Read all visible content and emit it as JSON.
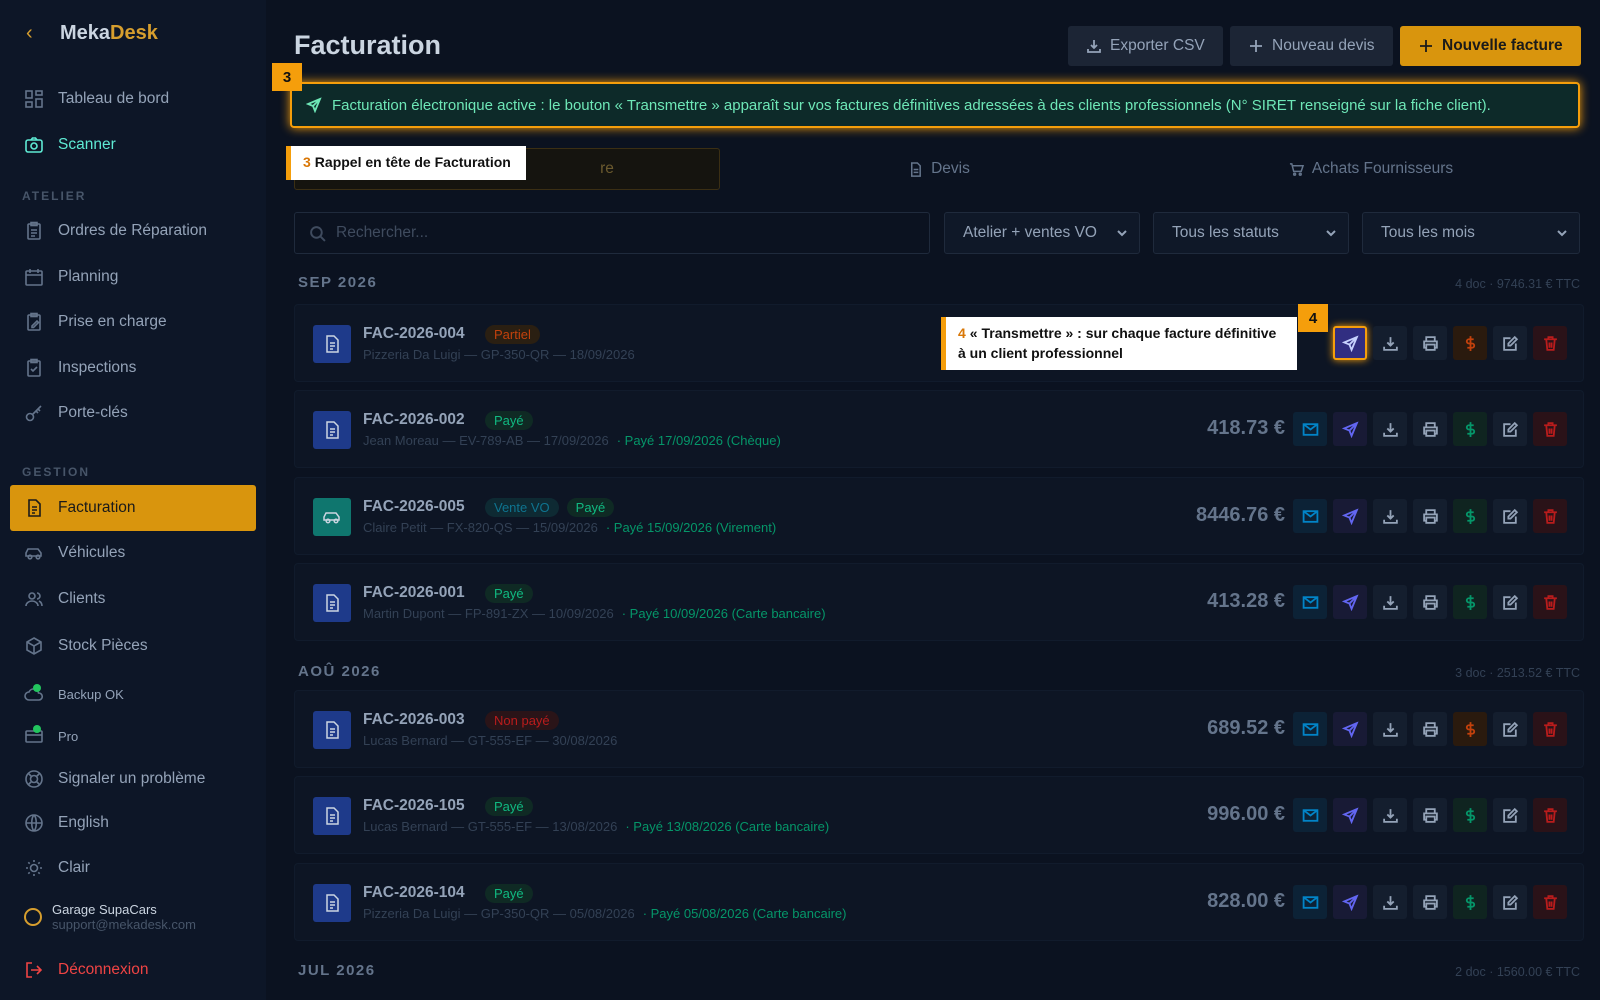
{
  "app": {
    "name_part1": "Meka",
    "name_part2": "Desk"
  },
  "sidebar": {
    "top_items": [
      {
        "label": "Tableau de bord",
        "icon": "dashboard-icon"
      },
      {
        "label": "Scanner",
        "icon": "camera-icon"
      }
    ],
    "section_atelier": "ATELIER",
    "atelier_items": [
      {
        "label": "Ordres de Réparation",
        "icon": "clipboard-icon"
      },
      {
        "label": "Planning",
        "icon": "calendar-icon"
      },
      {
        "label": "Prise en charge",
        "icon": "clipboard-edit-icon"
      },
      {
        "label": "Inspections",
        "icon": "clipboard-check-icon"
      },
      {
        "label": "Porte-clés",
        "icon": "key-icon"
      }
    ],
    "section_gestion": "GESTION",
    "gestion_items": [
      {
        "label": "Facturation",
        "icon": "file-text-icon"
      },
      {
        "label": "Véhicules",
        "icon": "car-icon"
      },
      {
        "label": "Clients",
        "icon": "users-icon"
      },
      {
        "label": "Stock Pièces",
        "icon": "box-icon"
      }
    ],
    "backup": "Backup OK",
    "plan": "Pro",
    "report": "Signaler un problème",
    "language": "English",
    "theme": "Clair",
    "user_name": "Garage SupaCars",
    "user_email": "support@mekadesk.com",
    "logout": "Déconnexion"
  },
  "header": {
    "title": "Facturation",
    "export_label": "Exporter CSV",
    "new_quote_label": "Nouveau devis",
    "new_invoice_label": "Nouvelle facture"
  },
  "banner": {
    "text": "Facturation électronique active : le bouton « Transmettre » apparaît sur vos factures définitives adressées à des clients professionnels (N° SIRET renseigné sur la fiche client)."
  },
  "tour": {
    "badge3": "3",
    "tip3_num": "3",
    "tip3_text": "Rappel en tête de Facturation",
    "badge4": "4",
    "tip4_num": "4",
    "tip4_text": "« Transmettre » : sur chaque facture définitive à un client professionnel"
  },
  "tabs": [
    {
      "label": "re",
      "icon": ""
    },
    {
      "label": "Devis",
      "icon": "file-icon"
    },
    {
      "label": "Achats Fournisseurs",
      "icon": "cart-icon"
    }
  ],
  "filters": {
    "search_placeholder": "Rechercher...",
    "type_value": "Atelier + ventes VO",
    "status_value": "Tous les statuts",
    "month_value": "Tous les mois"
  },
  "groups": [
    {
      "month": "SEP 2026",
      "summary": "4 doc · 9746.31 € TTC"
    },
    {
      "month": "AOÛ 2026",
      "summary": "3 doc · 2513.52 € TTC"
    },
    {
      "month": "JUL 2026",
      "summary": "2 doc · 1560.00 € TTC"
    }
  ],
  "invoices": [
    {
      "number": "FAC-2026-004",
      "chips": [
        "Partiel"
      ],
      "client": "Pizzeria Da Luigi — GP-350-QR — 18/09/2026",
      "payment": "",
      "amount": ""
    },
    {
      "number": "FAC-2026-002",
      "chips": [
        "Payé"
      ],
      "client": "Jean Moreau — EV-789-AB — 17/09/2026",
      "payment": "· Payé 17/09/2026 (Chèque)",
      "amount": "418.73 €"
    },
    {
      "number": "FAC-2026-005",
      "chips": [
        "Vente VO",
        "Payé"
      ],
      "client": "Claire Petit — FX-820-QS — 15/09/2026",
      "payment": "· Payé 15/09/2026 (Virement)",
      "amount": "8446.76 €"
    },
    {
      "number": "FAC-2026-001",
      "chips": [
        "Payé"
      ],
      "client": "Martin Dupont — FP-891-ZX — 10/09/2026",
      "payment": "· Payé 10/09/2026 (Carte bancaire)",
      "amount": "413.28 €"
    },
    {
      "number": "FAC-2026-003",
      "chips": [
        "Non payé"
      ],
      "client": "Lucas Bernard — GT-555-EF — 30/08/2026",
      "payment": "",
      "amount": "689.52 €"
    },
    {
      "number": "FAC-2026-105",
      "chips": [
        "Payé"
      ],
      "client": "Lucas Bernard — GT-555-EF — 13/08/2026",
      "payment": "· Payé 13/08/2026 (Carte bancaire)",
      "amount": "996.00 €"
    },
    {
      "number": "FAC-2026-104",
      "chips": [
        "Payé"
      ],
      "client": "Pizzeria Da Luigi — GP-350-QR — 05/08/2026",
      "payment": "· Payé 05/08/2026 (Carte bancaire)",
      "amount": "828.00 €"
    }
  ]
}
